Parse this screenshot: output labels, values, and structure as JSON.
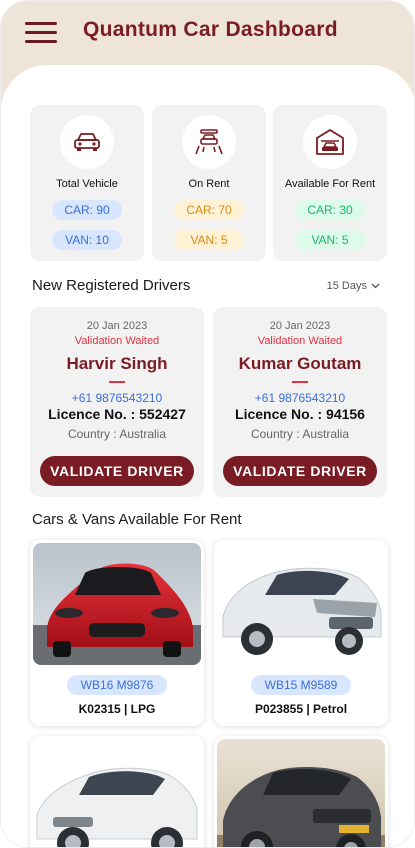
{
  "app": {
    "title": "Quantum Car Dashboard"
  },
  "colors": {
    "brand": "#7a1c24",
    "header_bg": "#efe4d8",
    "card_bg": "#f2f2f2",
    "blue": "#3a6fd8",
    "yellow": "#d98a1a",
    "green": "#21b46a",
    "alert": "#e0323e"
  },
  "stats": [
    {
      "label": "Total Vehicle",
      "icon": "car-icon",
      "car": "CAR:  90",
      "van": "VAN:  10",
      "tone": "blue"
    },
    {
      "label": "On Rent",
      "icon": "car-lift-icon",
      "car": "CAR:  70",
      "van": "VAN:  5",
      "tone": "yellow"
    },
    {
      "label": "Available For Rent",
      "icon": "garage-icon",
      "car": "CAR:  30",
      "van": "VAN:  5",
      "tone": "green"
    }
  ],
  "drivers_section": {
    "title": "New Registered Drivers",
    "filter": "15 Days"
  },
  "drivers": [
    {
      "date": "20 Jan 2023",
      "status": "Validation Waited",
      "name": "Harvir Singh",
      "phone": "+61 9876543210",
      "licence": "Licence No. : 552427",
      "country": "Country : Australia",
      "button": "VALIDATE DRIVER"
    },
    {
      "date": "20 Jan 2023",
      "status": "Validation Waited",
      "name": "Kumar Goutam",
      "phone": "+61 9876543210",
      "licence": "Licence No. : 94156",
      "country": "Country : Australia",
      "button": "VALIDATE DRIVER"
    }
  ],
  "vehicles_section": {
    "title": "Cars & Vans Available For Rent"
  },
  "vehicles": [
    {
      "plate": "WB16 M9876",
      "info": "K02315 | LPG",
      "image": "red-sports-car"
    },
    {
      "plate": "WB15 M9589",
      "info": "P023855 | Petrol",
      "image": "white-sedan"
    },
    {
      "image": "white-compact-sedan"
    },
    {
      "image": "grey-suv"
    }
  ]
}
